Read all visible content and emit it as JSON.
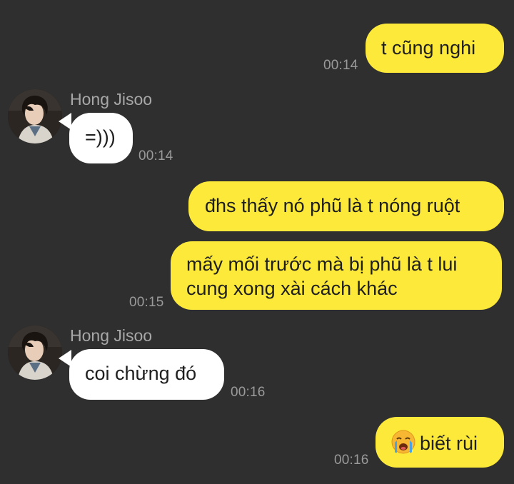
{
  "contact": {
    "name": "Hong Jisoo"
  },
  "messages": [
    {
      "direction": "outgoing",
      "text": "t cũng nghi",
      "time": "00:14"
    },
    {
      "direction": "incoming",
      "sender": "Hong Jisoo",
      "text": "=)))",
      "time": "00:14"
    },
    {
      "direction": "outgoing",
      "text": "đhs thấy nó phũ là t nóng ruột",
      "time": ""
    },
    {
      "direction": "outgoing",
      "line1": "mấy mối trước mà bị phũ là t lui",
      "line2": "cung xong xài cách khác",
      "time": "00:15"
    },
    {
      "direction": "incoming",
      "sender": "Hong Jisoo",
      "text": "coi chừng đó",
      "time": "00:16"
    },
    {
      "direction": "outgoing",
      "emoji": "loudly-crying-face",
      "text": "biết rùi",
      "time": "00:16"
    }
  ],
  "colors": {
    "background": "#2f2f2f",
    "outgoing_bubble": "#fde93a",
    "incoming_bubble": "#ffffff",
    "timestamp": "#9a9a9a",
    "sender_name": "#a8a8a8"
  }
}
